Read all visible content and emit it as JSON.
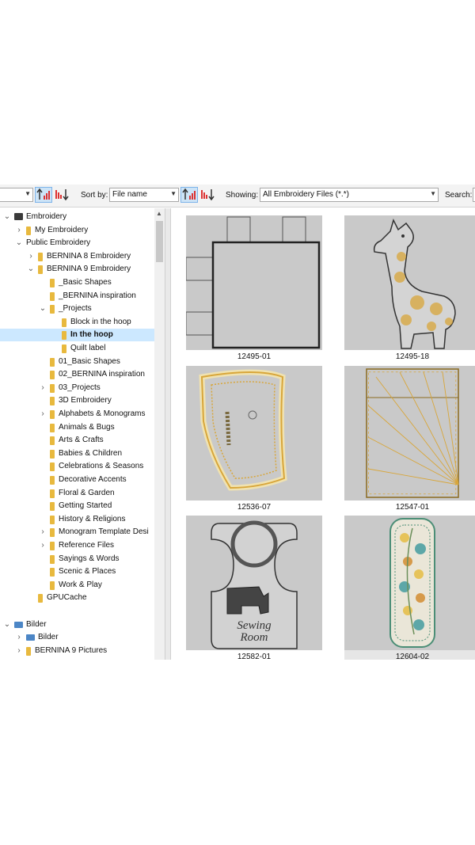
{
  "toolbar": {
    "sort_label": "Sort by:",
    "sort_value": "File name",
    "showing_label": "Showing:",
    "showing_value": "All Embroidery Files (*.*)",
    "search_label": "Search:"
  },
  "tree": {
    "items": [
      {
        "label": "Embroidery",
        "level": 0,
        "twisty": "open",
        "icon": "drive"
      },
      {
        "label": "My Embroidery",
        "level": 1,
        "twisty": "closed",
        "icon": "folder"
      },
      {
        "label": "Public Embroidery",
        "level": 1,
        "twisty": "open",
        "icon": "none"
      },
      {
        "label": "BERNINA 8 Embroidery",
        "level": 2,
        "twisty": "closed",
        "icon": "folder"
      },
      {
        "label": "BERNINA 9 Embroidery",
        "level": 2,
        "twisty": "open",
        "icon": "folder"
      },
      {
        "label": "_Basic Shapes",
        "level": 3,
        "twisty": "none",
        "icon": "folder"
      },
      {
        "label": "_BERNINA inspiration",
        "level": 3,
        "twisty": "none",
        "icon": "folder"
      },
      {
        "label": "_Projects",
        "level": 3,
        "twisty": "open",
        "icon": "folder"
      },
      {
        "label": "Block in the hoop",
        "level": 4,
        "twisty": "none",
        "icon": "folder"
      },
      {
        "label": "In the hoop",
        "level": 4,
        "twisty": "none",
        "icon": "folder",
        "selected": true
      },
      {
        "label": "Quilt label",
        "level": 4,
        "twisty": "none",
        "icon": "folder"
      },
      {
        "label": "01_Basic Shapes",
        "level": 3,
        "twisty": "none",
        "icon": "folder"
      },
      {
        "label": "02_BERNINA inspiration",
        "level": 3,
        "twisty": "none",
        "icon": "folder"
      },
      {
        "label": "03_Projects",
        "level": 3,
        "twisty": "closed",
        "icon": "folder"
      },
      {
        "label": "3D Embroidery",
        "level": 3,
        "twisty": "none",
        "icon": "folder"
      },
      {
        "label": "Alphabets & Monograms",
        "level": 3,
        "twisty": "closed",
        "icon": "folder"
      },
      {
        "label": "Animals & Bugs",
        "level": 3,
        "twisty": "none",
        "icon": "folder"
      },
      {
        "label": "Arts & Crafts",
        "level": 3,
        "twisty": "none",
        "icon": "folder"
      },
      {
        "label": "Babies & Children",
        "level": 3,
        "twisty": "none",
        "icon": "folder"
      },
      {
        "label": "Celebrations & Seasons",
        "level": 3,
        "twisty": "none",
        "icon": "folder"
      },
      {
        "label": "Decorative Accents",
        "level": 3,
        "twisty": "none",
        "icon": "folder"
      },
      {
        "label": "Floral & Garden",
        "level": 3,
        "twisty": "none",
        "icon": "folder"
      },
      {
        "label": "Getting Started",
        "level": 3,
        "twisty": "none",
        "icon": "folder"
      },
      {
        "label": "History & Religions",
        "level": 3,
        "twisty": "none",
        "icon": "folder"
      },
      {
        "label": "Monogram Template Desi",
        "level": 3,
        "twisty": "closed",
        "icon": "folder"
      },
      {
        "label": "Reference Files",
        "level": 3,
        "twisty": "closed",
        "icon": "folder"
      },
      {
        "label": "Sayings & Words",
        "level": 3,
        "twisty": "none",
        "icon": "folder"
      },
      {
        "label": "Scenic & Places",
        "level": 3,
        "twisty": "none",
        "icon": "folder"
      },
      {
        "label": "Work & Play",
        "level": 3,
        "twisty": "none",
        "icon": "folder"
      },
      {
        "label": "GPUCache",
        "level": 2,
        "twisty": "none",
        "icon": "folder"
      },
      {
        "label": "",
        "level": 0,
        "twisty": "none",
        "icon": "none"
      },
      {
        "label": "Bilder",
        "level": 0,
        "twisty": "open",
        "icon": "pics"
      },
      {
        "label": "Bilder",
        "level": 1,
        "twisty": "closed",
        "icon": "pics"
      },
      {
        "label": "BERNINA 9 Pictures",
        "level": 1,
        "twisty": "closed",
        "icon": "folder"
      }
    ]
  },
  "grid": {
    "tiles": [
      {
        "name": "12495-01",
        "design": "block",
        "selected": false
      },
      {
        "name": "12495-18",
        "design": "giraffe",
        "selected": false
      },
      {
        "name": "12536-07",
        "design": "band",
        "selected": false
      },
      {
        "name": "12547-01",
        "design": "rays",
        "selected": false
      },
      {
        "name": "12582-01",
        "design": "sewing-room",
        "selected": false
      },
      {
        "name": "12604-02",
        "design": "floral-strip",
        "selected": true
      }
    ],
    "tile_colors": {
      "background": "#c9c9c9",
      "stitch_gold": "#d8a63a",
      "outline": "#555555"
    },
    "sewing_room_text": [
      "Sewing",
      "Room"
    ]
  }
}
